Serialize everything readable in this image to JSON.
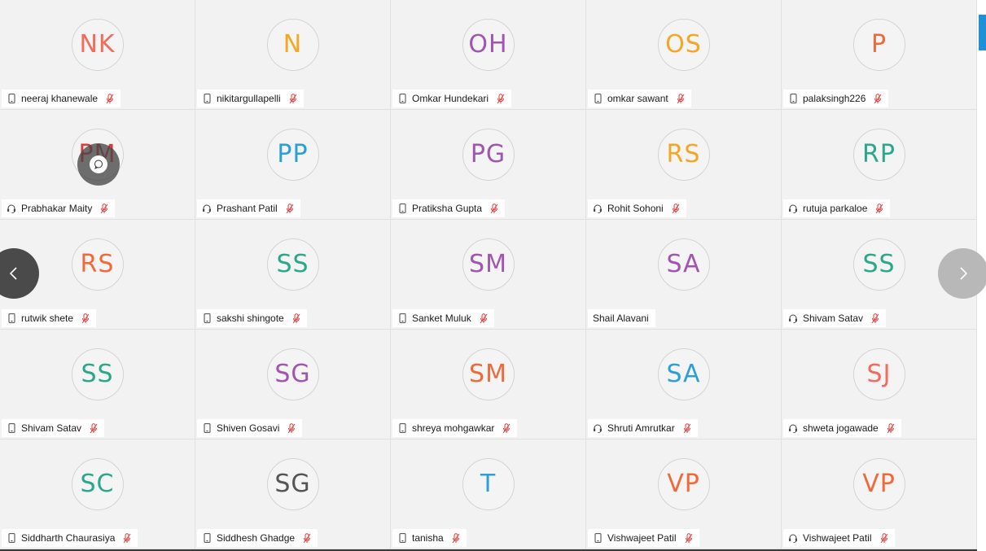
{
  "participants": [
    {
      "initials": "NK",
      "name": "neeraj khanewale",
      "color": "#f26b5b",
      "device": "phone",
      "muted": true
    },
    {
      "initials": "N",
      "name": "nikitargullapelli",
      "color": "#f5a623",
      "device": "phone",
      "muted": true
    },
    {
      "initials": "OH",
      "name": "Omkar Hundekari",
      "color": "#a055b0",
      "device": "phone",
      "muted": true
    },
    {
      "initials": "OS",
      "name": "omkar sawant",
      "color": "#f5a623",
      "device": "phone",
      "muted": true
    },
    {
      "initials": "P",
      "name": "palaksingh226",
      "color": "#ef6a3a",
      "device": "phone",
      "muted": true
    },
    {
      "initials": "PM",
      "name": "Prabhakar Maity",
      "color": "#e0393a",
      "device": "headset",
      "muted": true
    },
    {
      "initials": "PP",
      "name": "Prashant Patil",
      "color": "#2b9fd9",
      "device": "headset",
      "muted": true
    },
    {
      "initials": "PG",
      "name": "Pratiksha Gupta",
      "color": "#a055b0",
      "device": "phone",
      "muted": true
    },
    {
      "initials": "RS",
      "name": "Rohit Sohoni",
      "color": "#f5a623",
      "device": "headset",
      "muted": true
    },
    {
      "initials": "RP",
      "name": "rutuja parkaloe",
      "color": "#2aa889",
      "device": "headset",
      "muted": true
    },
    {
      "initials": "RS",
      "name": "rutwik shete",
      "color": "#ef6a3a",
      "device": "phone",
      "muted": true
    },
    {
      "initials": "SS",
      "name": "sakshi shingote",
      "color": "#2aa889",
      "device": "phone",
      "muted": true
    },
    {
      "initials": "SM",
      "name": "Sanket Muluk",
      "color": "#a055b0",
      "device": "phone",
      "muted": true
    },
    {
      "initials": "SA",
      "name": "Shail Alavani",
      "color": "#a055b0",
      "device": "none",
      "muted": false
    },
    {
      "initials": "SS",
      "name": "Shivam Satav",
      "color": "#2aa889",
      "device": "headset",
      "muted": true
    },
    {
      "initials": "SS",
      "name": "Shivam Satav",
      "color": "#2aa889",
      "device": "phone",
      "muted": true
    },
    {
      "initials": "SG",
      "name": "Shiven Gosavi",
      "color": "#a055b0",
      "device": "phone",
      "muted": true
    },
    {
      "initials": "SM",
      "name": "shreya mohgawkar",
      "color": "#ef6a3a",
      "device": "phone",
      "muted": true
    },
    {
      "initials": "SA",
      "name": "Shruti Amrutkar",
      "color": "#2b9fd9",
      "device": "headset",
      "muted": true
    },
    {
      "initials": "SJ",
      "name": "shweta jogawade",
      "color": "#f26b5b",
      "device": "headset",
      "muted": true
    },
    {
      "initials": "SC",
      "name": "Siddharth Chaurasiya",
      "color": "#2aa889",
      "device": "phone",
      "muted": true
    },
    {
      "initials": "SG",
      "name": "Siddhesh Ghadge",
      "color": "#555555",
      "device": "phone",
      "muted": true
    },
    {
      "initials": "T",
      "name": "tanisha",
      "color": "#2b9fd9",
      "device": "phone",
      "muted": true
    },
    {
      "initials": "VP",
      "name": "Vishwajeet Patil",
      "color": "#ef6a3a",
      "device": "phone",
      "muted": true
    },
    {
      "initials": "VP",
      "name": "Vishwajeet Patil",
      "color": "#ef6a3a",
      "device": "headset",
      "muted": true
    }
  ],
  "chat_bubble_on": 5,
  "icons": {
    "phone": "phone-icon",
    "headset": "headset-icon",
    "mic_muted": "mic-muted-icon",
    "chat": "chat-icon",
    "prev": "chevron-left-icon",
    "next": "chevron-right-icon"
  },
  "colors": {
    "tile_bg": "#f2f2f2",
    "muted_red": "#e0393a",
    "scroll_accent": "#1e90d6"
  }
}
